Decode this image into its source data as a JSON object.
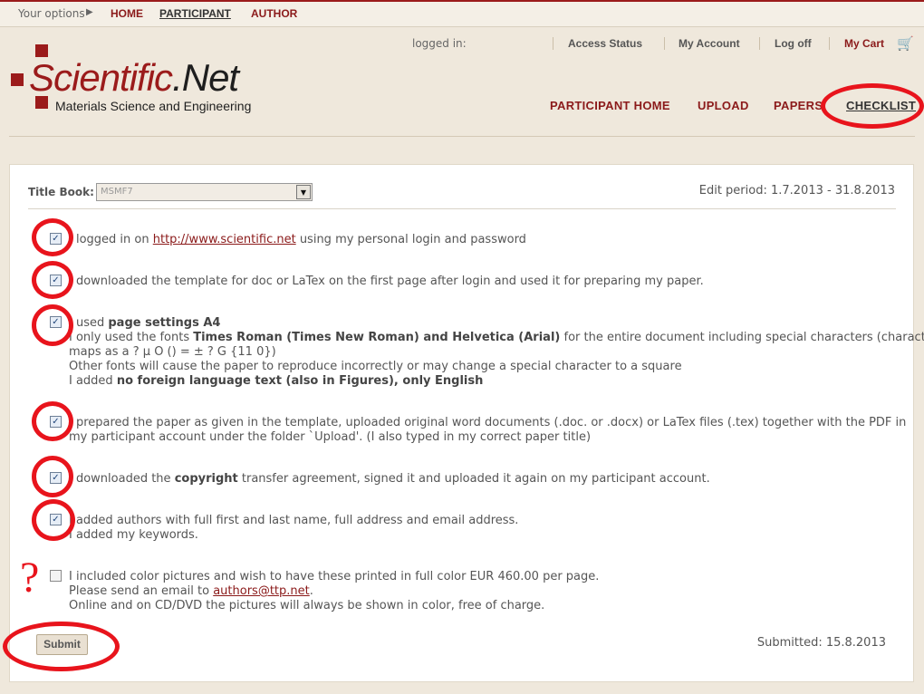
{
  "topbar": {
    "your_options": "Your options",
    "arrow": "▶",
    "links": [
      {
        "label": "HOME"
      },
      {
        "label": "PARTICIPANT"
      },
      {
        "label": "AUTHOR"
      }
    ]
  },
  "header": {
    "logo_main_left": "Scientific",
    "logo_main_right": ".Net",
    "logo_subtitle": "Materials Science and Engineering",
    "logged_in": "logged in:",
    "account_links": [
      {
        "label": "Access Status"
      },
      {
        "label": "My Account"
      },
      {
        "label": "Log off"
      },
      {
        "label": "My Cart"
      }
    ],
    "cart_icon": "🛒",
    "main_nav": [
      {
        "label": "PARTICIPANT HOME"
      },
      {
        "label": "UPLOAD"
      },
      {
        "label": "PAPERS"
      },
      {
        "label": "CHECKLIST"
      }
    ]
  },
  "form": {
    "title_book_label": "Title Book:",
    "title_book_value": "MSMF7",
    "edit_period": "Edit period: 1.7.2013 - 31.8.2013",
    "check_mark": "✓",
    "items": [
      {
        "checked": true,
        "l1_prefix": "I logged in on ",
        "l1_link": "http://www.scientific.net",
        "l1_suffix": " using my personal login and password"
      },
      {
        "checked": true,
        "l1": "I downloaded the template for doc or LaTex on the first page after login and used it for preparing my paper."
      },
      {
        "checked": true,
        "l1_prefix": "I used ",
        "l1_bold": "page settings A4",
        "l2_prefix": "I only used the fonts ",
        "l2_bold": "Times Roman (Times New Roman) and Helvetica (Arial)",
        "l2_suffix": " for the entire document including special characters (character",
        "l3": "maps as a ? μ Ο () = ± ? G {11 0})",
        "l4": "Other fonts will cause the paper to reproduce incorrectly or may change a special character to a square",
        "l5_prefix": "I added ",
        "l5_bold": "no foreign language text (also in Figures), only English"
      },
      {
        "checked": true,
        "l1": "I prepared the paper as given in the template, uploaded original word documents (.doc. or .docx) or LaTex files (.tex) together with the PDF in",
        "l2": "my participant account under the folder `Upload'. (I also typed in my correct paper title)"
      },
      {
        "checked": true,
        "l1_prefix": "I downloaded the ",
        "l1_bold": "copyright",
        "l1_suffix": " transfer agreement, signed it and uploaded it again on my participant account."
      },
      {
        "checked": true,
        "l1": "I added authors with full first and last name, full address and email address.",
        "l2": "I added my keywords."
      },
      {
        "checked": false,
        "l1": "I included color pictures and wish to have these printed in full color EUR 460.00 per page.",
        "l2_prefix": "Please send an email to ",
        "l2_link": "authors@ttp.net",
        "l2_suffix": ".",
        "l3": "Online and on CD/DVD the pictures will always be shown in color, free of charge."
      }
    ],
    "submit_label": "Submit",
    "submitted": "Submitted: 15.8.2013"
  },
  "annotation": {
    "question_mark": "?",
    "accent_color": "#e8141c"
  }
}
